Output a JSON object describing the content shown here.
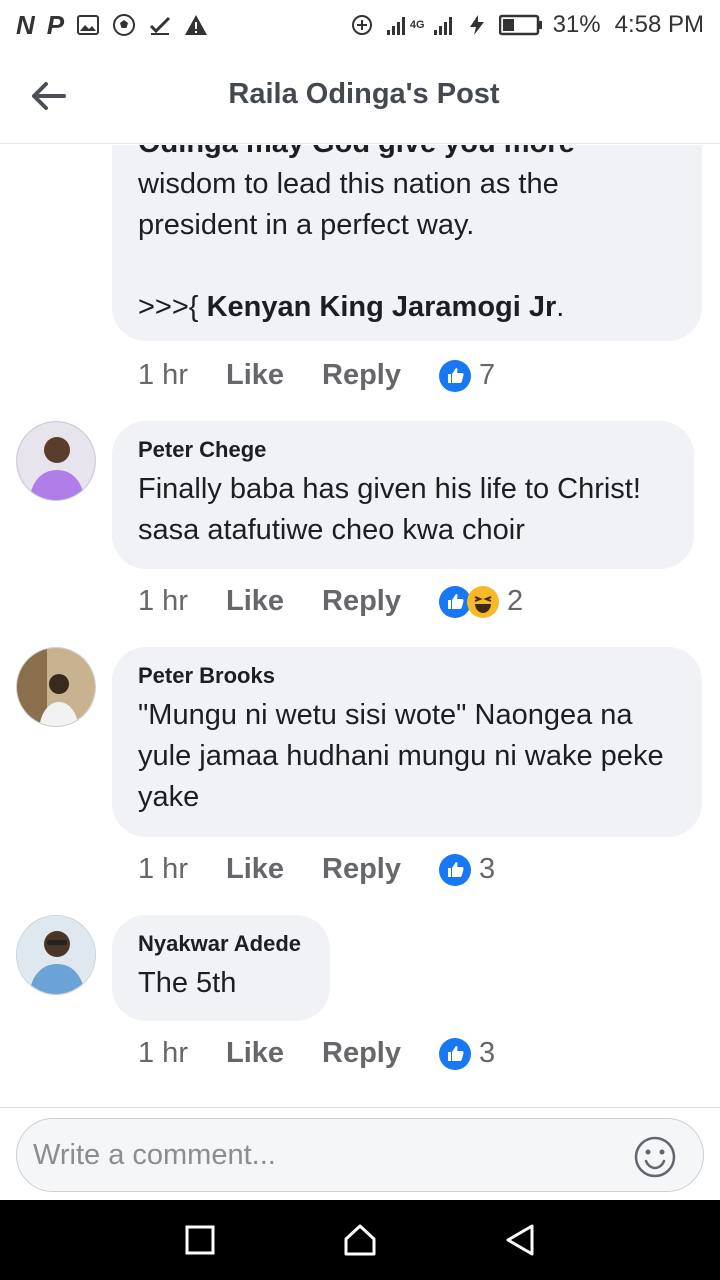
{
  "status_bar": {
    "left_letters": [
      "N",
      "P"
    ],
    "left_icons": [
      "image-icon",
      "soccer-ball-icon",
      "checkmark-icon",
      "warning-icon"
    ],
    "network_label": "4G",
    "battery": "31%",
    "time": "4:58 PM"
  },
  "header": {
    "title": "Raila Odinga's Post"
  },
  "comments": [
    {
      "truncated_top": "Odinga may God give you more",
      "text_plain": "wisdom to lead this nation as the president in a perfect way.",
      "signoff_prefix": ">>>{ ",
      "signoff_bold": "Kenyan King Jaramogi Jr",
      "signoff_suffix": ".",
      "time": "1 hr",
      "like": "Like",
      "reply": "Reply",
      "reaction_count": "7"
    },
    {
      "author": "Peter Chege",
      "text": "Finally baba has given his life to Christ! sasa atafutiwe cheo kwa choir",
      "time": "1 hr",
      "like": "Like",
      "reply": "Reply",
      "reaction_count": "2"
    },
    {
      "author": "Peter Brooks",
      "text": "\"Mungu ni wetu sisi wote\" Naongea na yule jamaa hudhani mungu ni wake peke yake",
      "time": "1 hr",
      "like": "Like",
      "reply": "Reply",
      "reaction_count": "3"
    },
    {
      "author": "Nyakwar Adede",
      "text": "The 5th",
      "time": "1 hr",
      "like": "Like",
      "reply": "Reply",
      "reaction_count": "3"
    }
  ],
  "composer": {
    "placeholder": "Write a comment..."
  },
  "colors": {
    "like_blue": "#1877f2",
    "haha_yellow": "#f7b928",
    "bubble_bg": "#f0f2f5",
    "meta_gray": "#65676b"
  }
}
